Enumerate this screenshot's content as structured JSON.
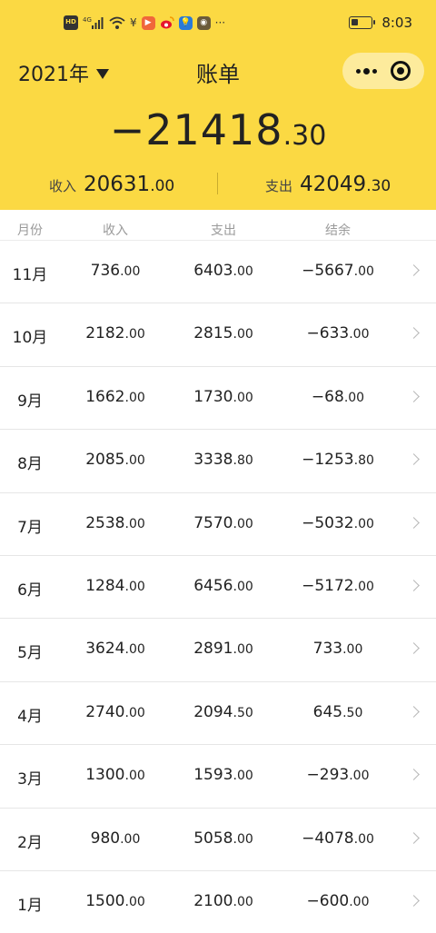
{
  "status_bar": {
    "hd_badge": "HD",
    "network": "4G",
    "yen_symbol": "¥",
    "more": "···",
    "time": "8:03",
    "battery_level": 0.35
  },
  "header": {
    "year_label": "2021年",
    "title": "账单",
    "balance_int": "−21418",
    "balance_dec": ".30",
    "income_label": "收入",
    "income_int": "20631",
    "income_dec": ".00",
    "expense_label": "支出",
    "expense_int": "42049",
    "expense_dec": ".30"
  },
  "columns": [
    "月份",
    "收入",
    "支出",
    "结余"
  ],
  "rows": [
    {
      "month": "11月",
      "income_int": "736",
      "income_dec": ".00",
      "expense_int": "6403",
      "expense_dec": ".00",
      "balance_int": "−5667",
      "balance_dec": ".00"
    },
    {
      "month": "10月",
      "income_int": "2182",
      "income_dec": ".00",
      "expense_int": "2815",
      "expense_dec": ".00",
      "balance_int": "−633",
      "balance_dec": ".00"
    },
    {
      "month": "9月",
      "income_int": "1662",
      "income_dec": ".00",
      "expense_int": "1730",
      "expense_dec": ".00",
      "balance_int": "−68",
      "balance_dec": ".00"
    },
    {
      "month": "8月",
      "income_int": "2085",
      "income_dec": ".00",
      "expense_int": "3338",
      "expense_dec": ".80",
      "balance_int": "−1253",
      "balance_dec": ".80"
    },
    {
      "month": "7月",
      "income_int": "2538",
      "income_dec": ".00",
      "expense_int": "7570",
      "expense_dec": ".00",
      "balance_int": "−5032",
      "balance_dec": ".00"
    },
    {
      "month": "6月",
      "income_int": "1284",
      "income_dec": ".00",
      "expense_int": "6456",
      "expense_dec": ".00",
      "balance_int": "−5172",
      "balance_dec": ".00"
    },
    {
      "month": "5月",
      "income_int": "3624",
      "income_dec": ".00",
      "expense_int": "2891",
      "expense_dec": ".00",
      "balance_int": "733",
      "balance_dec": ".00"
    },
    {
      "month": "4月",
      "income_int": "2740",
      "income_dec": ".00",
      "expense_int": "2094",
      "expense_dec": ".50",
      "balance_int": "645",
      "balance_dec": ".50"
    },
    {
      "month": "3月",
      "income_int": "1300",
      "income_dec": ".00",
      "expense_int": "1593",
      "expense_dec": ".00",
      "balance_int": "−293",
      "balance_dec": ".00"
    },
    {
      "month": "2月",
      "income_int": "980",
      "income_dec": ".00",
      "expense_int": "5058",
      "expense_dec": ".00",
      "balance_int": "−4078",
      "balance_dec": ".00"
    },
    {
      "month": "1月",
      "income_int": "1500",
      "income_dec": ".00",
      "expense_int": "2100",
      "expense_dec": ".00",
      "balance_int": "−600",
      "balance_dec": ".00"
    }
  ],
  "colors": {
    "header_bg": "#fbd943",
    "capsule_bg": "#fdeb9c",
    "row_divider": "#e6e6e6",
    "column_header_text": "#9a9a9a"
  },
  "icons": {
    "year_dropdown": "triangle-down-icon",
    "more": "more-dots-icon",
    "close": "target-circle-icon",
    "row_arrow": "chevron-right-icon"
  }
}
